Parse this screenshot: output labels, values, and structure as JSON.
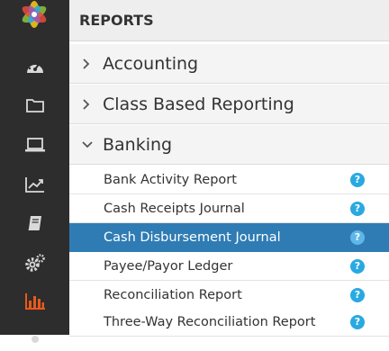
{
  "header": {
    "title": "REPORTS"
  },
  "sidebar": {
    "icons": [
      "logo",
      "dashboard-gauge-icon",
      "folder-icon",
      "laptop-icon",
      "trending-chart-icon",
      "book-icon",
      "settings-gears-icon",
      "bar-chart-icon"
    ],
    "active_color": "#e8591a"
  },
  "sections": [
    {
      "label": "Accounting",
      "expanded": false
    },
    {
      "label": "Class Based Reporting",
      "expanded": false
    },
    {
      "label": "Banking",
      "expanded": true
    }
  ],
  "banking_items": [
    {
      "label": "Bank Activity Report",
      "help": "?"
    },
    {
      "label": "Cash Receipts Journal",
      "help": "?"
    },
    {
      "label": "Cash Disbursement Journal",
      "help": "?",
      "selected": true
    },
    {
      "label": "Payee/Payor Ledger",
      "help": "?"
    },
    {
      "label": "Reconciliation Report",
      "help": "?"
    },
    {
      "label": "Three-Way Reconciliation Report",
      "help": "?"
    }
  ],
  "colors": {
    "selected_row": "#2f7cb4",
    "help_icon": "#29a9e1",
    "rail": "#2d2d2d"
  }
}
